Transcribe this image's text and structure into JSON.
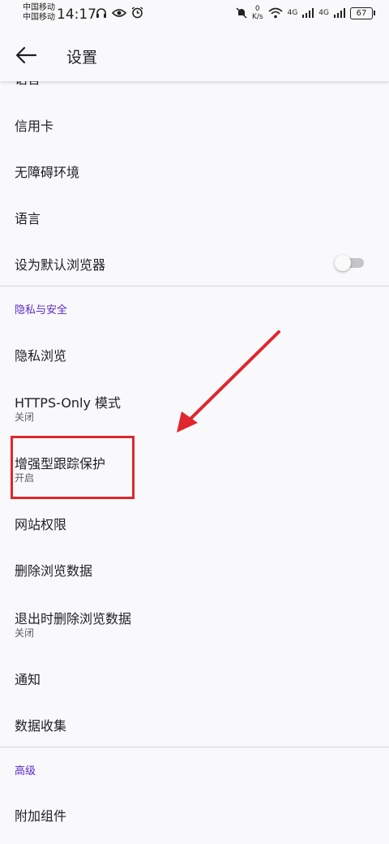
{
  "status_bar": {
    "carrier_1": "中国移动",
    "carrier_2": "中国移动",
    "time": "14:17",
    "net_speed_value": "0",
    "net_speed_unit": "K/s",
    "signal_1": "4G",
    "signal_2": "4G",
    "battery": "67"
  },
  "app_bar": {
    "title": "设置"
  },
  "clipped_item": "语言",
  "items": {
    "credit_card": "信用卡",
    "accessibility": "无障碍环境",
    "language": "语言",
    "default_browser": "设为默认浏览器",
    "private_browsing": "隐私浏览",
    "https_only": "HTTPS-Only 模式",
    "https_only_status": "关闭",
    "tracking_protection": "增强型跟踪保护",
    "tracking_protection_status": "开启",
    "site_permissions": "网站权限",
    "delete_browsing_data": "删除浏览数据",
    "delete_on_quit": "退出时删除浏览数据",
    "delete_on_quit_status": "关闭",
    "notifications": "通知",
    "data_collection": "数据收集",
    "addons": "附加组件"
  },
  "sections": {
    "privacy_security": "隐私与安全",
    "advanced": "高级"
  },
  "toggles": {
    "default_browser_on": false
  },
  "colors": {
    "accent": "#592acb",
    "annotation": "#e0262e",
    "background": "#f9f9fb"
  }
}
